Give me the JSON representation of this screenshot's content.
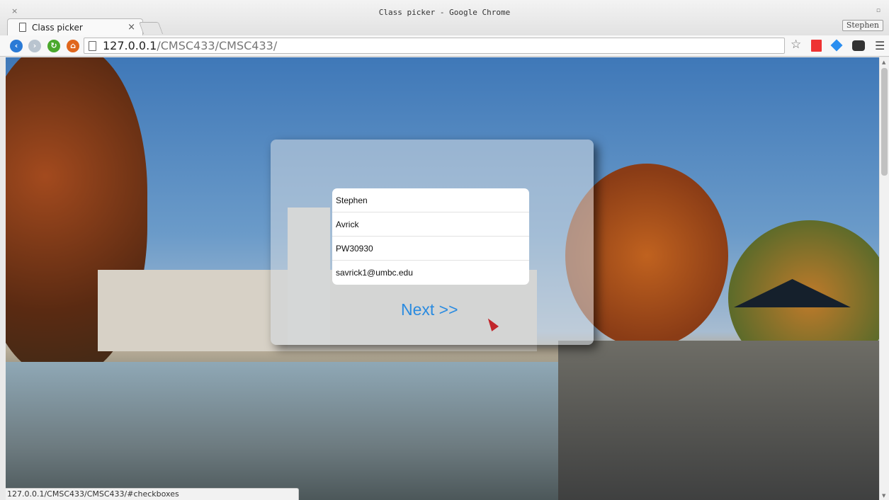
{
  "window": {
    "title": "Class picker - Google Chrome",
    "close_glyph": "×",
    "restore_glyph": "▫"
  },
  "tabs": [
    {
      "label": "Class picker",
      "close_glyph": "×"
    }
  ],
  "profile": {
    "name": "Stephen"
  },
  "toolbar": {
    "url_host": "127.0.0.1",
    "url_path": "/CMSC433/CMSC433/",
    "icons": [
      "back-icon",
      "forward-icon",
      "reload-icon",
      "home-icon",
      "star-icon",
      "bookmark-extension-icon",
      "diamond-extension-icon",
      "mask-extension-icon",
      "menu-icon"
    ]
  },
  "form": {
    "first_name": "Stephen",
    "last_name": "Avrick",
    "campus_id": "PW30930",
    "email": "savrick1@umbc.edu",
    "next_label": "Next >>"
  },
  "status": {
    "url": "127.0.0.1/CMSC433/CMSC433/#checkboxes"
  },
  "colors": {
    "accent": "#2a8be0",
    "omnibox_path": "#777777"
  }
}
